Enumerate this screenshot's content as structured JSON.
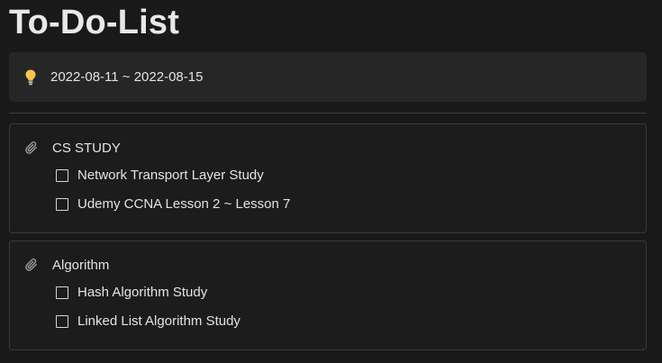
{
  "page": {
    "title": "To-Do-List"
  },
  "callout": {
    "icon": "lightbulb-icon",
    "text": "2022-08-11 ~ 2022-08-15"
  },
  "groups": [
    {
      "icon": "paperclip-icon",
      "title": "CS STUDY",
      "todos": [
        {
          "label": "Network Transport Layer Study",
          "checked": false
        },
        {
          "label": "Udemy CCNA Lesson 2 ~ Lesson 7",
          "checked": false
        }
      ]
    },
    {
      "icon": "paperclip-icon",
      "title": "Algorithm",
      "todos": [
        {
          "label": "Hash Algorithm Study",
          "checked": false
        },
        {
          "label": "Linked List Algorithm Study",
          "checked": false
        }
      ]
    }
  ],
  "colors": {
    "background": "#191919",
    "callout_background": "#262626",
    "text": "#e3e3e3",
    "bulb": "#f5c451"
  }
}
